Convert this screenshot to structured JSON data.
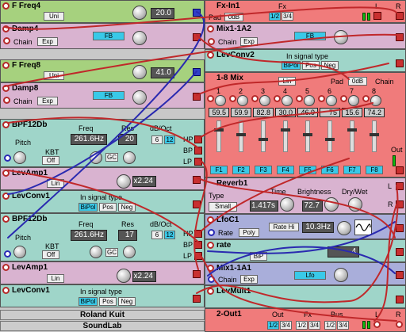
{
  "modules": {
    "ffreq4": {
      "title": "F Freq4",
      "mode": "Uni",
      "value": "20.0"
    },
    "damp4": {
      "title": "Damp4",
      "chain": "Chain",
      "exp": "Exp",
      "fb": "FB"
    },
    "ffreq8": {
      "title": "F Freq8",
      "mode": "Uni",
      "value": "41.0"
    },
    "damp8": {
      "title": "Damp8",
      "chain": "Chain",
      "exp": "Exp",
      "fb": "FB"
    },
    "bpf1": {
      "title": "BPF12Db",
      "freq_label": "Freq",
      "res_label": "Res",
      "db_label": "dB/Oct",
      "freq": "261.6Hz",
      "res": "20",
      "db6": "6",
      "db12": "12",
      "pitch": "Pitch",
      "kbt": "KBT",
      "kbt_val": "Off",
      "gc": "GC",
      "hp": "HP",
      "bp": "BP",
      "lp": "LP"
    },
    "levamp1a": {
      "title": "LevAmp1",
      "mode": "Lin",
      "value": "x2.24"
    },
    "levconv1a": {
      "title": "LevConv1",
      "type_label": "In signal type",
      "bipol": "BiPol",
      "pos": "Pos",
      "neg": "Neg"
    },
    "bpf2": {
      "title": "BPF12Db",
      "freq_label": "Freq",
      "res_label": "Res",
      "db_label": "dB/Oct",
      "freq": "261.6Hz",
      "res": "17",
      "db6": "6",
      "db12": "12",
      "pitch": "Pitch",
      "kbt": "KBT",
      "kbt_val": "Off",
      "gc": "GC",
      "hp": "HP",
      "bp": "BP",
      "lp": "LP"
    },
    "levamp1b": {
      "title": "LevAmp1",
      "mode": "Lin",
      "value": "x2.24"
    },
    "levconv1b": {
      "title": "LevConv1",
      "type_label": "In signal type",
      "bipol": "BiPol",
      "pos": "Pos",
      "neg": "Neg"
    },
    "fxin1": {
      "title": "Fx-In1",
      "pad": "Pad",
      "pad_val": "0dB",
      "fx": "Fx",
      "sel12": "1/2",
      "sel34": "3/4",
      "l": "L",
      "r": "R"
    },
    "mix1a2": {
      "title": "Mix1-1A2",
      "chain": "Chain",
      "exp": "Exp",
      "fb": "FB"
    },
    "levconv2": {
      "title": "LevConv2",
      "type_label": "In signal type",
      "bipol": "BiPol",
      "pos": "Pos",
      "neg": "Neg"
    },
    "mix18": {
      "title": "1-8 Mix",
      "lin": "Lin",
      "pad": "Pad",
      "pad_val": "0dB",
      "chain": "Chain",
      "out": "Out",
      "channels": [
        {
          "n": "1",
          "v": "59.5",
          "f": "F1"
        },
        {
          "n": "2",
          "v": "59.9",
          "f": "F2"
        },
        {
          "n": "3",
          "v": "82.8",
          "f": "F3"
        },
        {
          "n": "4",
          "v": "30.0",
          "f": "F4"
        },
        {
          "n": "5",
          "v": "46.9",
          "f": "F5"
        },
        {
          "n": "6",
          "v": "75",
          "f": "F6"
        },
        {
          "n": "7",
          "v": "15.6",
          "f": "F7"
        },
        {
          "n": "8",
          "v": "74.2",
          "f": "F8"
        }
      ]
    },
    "reverb1": {
      "title": "Reverb1",
      "type_label": "Type",
      "type_val": "Small",
      "time_label": "Time",
      "time": "1.417s",
      "bright_label": "Brightness",
      "bright": "72.7",
      "dw_label": "Dry/Wet",
      "l": "L",
      "r": "R"
    },
    "lfoc1": {
      "title": "LfoC1",
      "rate": "Rate",
      "poly": "Poly",
      "ratehi": "Rate Hi",
      "freq": "10.3Hz"
    },
    "rate": {
      "title": "rate",
      "bip": "BiP",
      "value": "4"
    },
    "mix1a1": {
      "title": "Mix1-1A1",
      "chain": "Chain",
      "exp": "Exp",
      "lfo": "Lfo"
    },
    "levmult1": {
      "title": "LevMult1"
    },
    "out1": {
      "title": "2-Out1",
      "out": "Out",
      "fx": "Fx",
      "bus": "Bus",
      "s1": "1/2",
      "s2": "3/4",
      "s3": "1/2",
      "s4": "3/4",
      "s5": "1/2",
      "s6": "3/4",
      "l": "L",
      "r": "R"
    }
  },
  "footer": {
    "line1": "Roland Kuit",
    "line2": "SoundLab"
  },
  "colors": {
    "green": "#a6d17e",
    "pink": "#d9b3d0",
    "teal": "#9fd5c9",
    "red": "#f07b7b",
    "violet": "#a9aeda",
    "cable_red": "#c0282a",
    "cable_blue": "#2a2ab0"
  }
}
